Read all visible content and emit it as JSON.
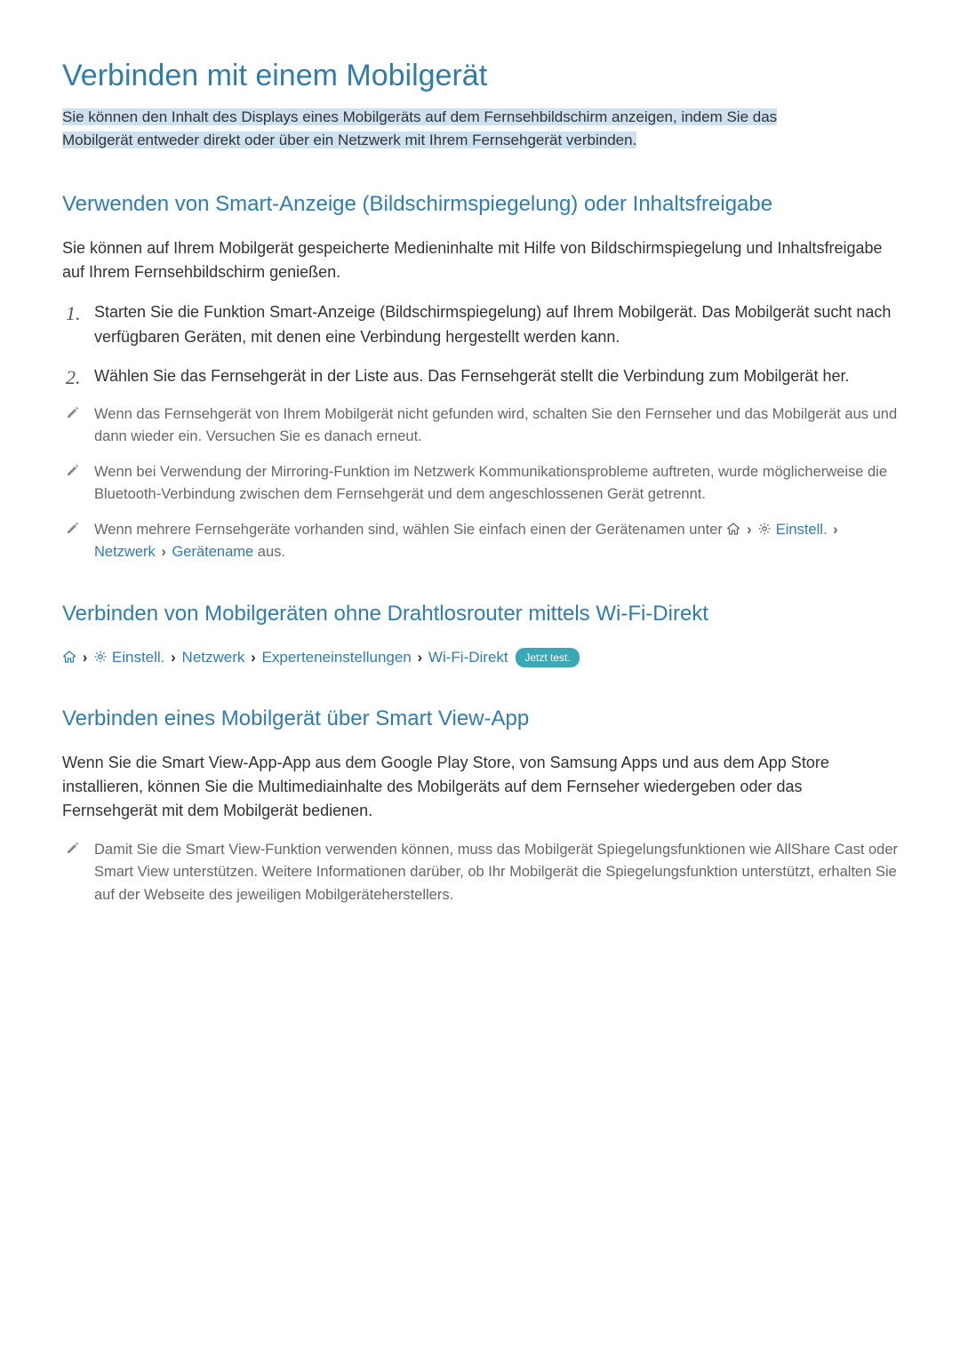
{
  "page": {
    "title": "Verbinden mit einem Mobilgerät",
    "intro_highlight1": "Sie können den Inhalt des Displays eines Mobilgeräts auf dem Fernsehbildschirm anzeigen, indem Sie das ",
    "intro_highlight2": "Mobilgerät entweder direkt oder über ein Netzwerk mit Ihrem Fernsehgerät verbinden."
  },
  "section1": {
    "heading": "Verwenden von Smart-Anzeige (Bildschirmspiegelung) oder Inhaltsfreigabe",
    "intro": "Sie können auf Ihrem Mobilgerät gespeicherte Medieninhalte mit Hilfe von Bildschirmspiegelung und Inhaltsfreigabe auf Ihrem Fernsehbildschirm genießen.",
    "step1": "Starten Sie die Funktion Smart-Anzeige (Bildschirmspiegelung) auf Ihrem Mobilgerät. Das Mobilgerät sucht nach verfügbaren Geräten, mit denen eine Verbindung hergestellt werden kann.",
    "step2": "Wählen Sie das Fernsehgerät in der Liste aus. Das Fernsehgerät stellt die Verbindung zum Mobilgerät her.",
    "note1": "Wenn das Fernsehgerät von Ihrem Mobilgerät nicht gefunden wird, schalten Sie den Fernseher und das Mobilgerät aus und dann wieder ein. Versuchen Sie es danach erneut.",
    "note2": "Wenn bei Verwendung der Mirroring-Funktion im Netzwerk Kommunikationsprobleme auftreten, wurde möglicherweise die Bluetooth-Verbindung zwischen dem Fernsehgerät und dem angeschlossenen Gerät getrennt.",
    "note3_pre": "Wenn mehrere Fernsehgeräte vorhanden sind, wählen Sie einfach einen der Gerätenamen unter ",
    "note3_path_settings": "Einstell.",
    "note3_path_network": "Netzwerk",
    "note3_path_devicename": "Gerätename",
    "note3_post": " aus."
  },
  "section2": {
    "heading": "Verbinden von Mobilgeräten ohne Drahtlosrouter mittels Wi-Fi-Direkt",
    "path_settings": "Einstell.",
    "path_network": "Netzwerk",
    "path_expert": "Experteneinstellungen",
    "path_wifidirect": "Wi-Fi-Direkt",
    "badge": "Jetzt test."
  },
  "section3": {
    "heading": "Verbinden eines Mobilgerät über Smart View-App",
    "body": "Wenn Sie die Smart View-App-App aus dem Google Play Store, von Samsung Apps und aus dem App Store installieren, können Sie die Multimediainhalte des Mobilgeräts auf dem Fernseher wiedergeben oder das Fernsehgerät mit dem Mobilgerät bedienen.",
    "note1": "Damit Sie die Smart View-Funktion verwenden können, muss das Mobilgerät Spiegelungsfunktionen wie AllShare Cast oder Smart View unterstützen. Weitere Informationen darüber, ob Ihr Mobilgerät die Spiegelungsfunktion unterstützt, erhalten Sie auf der Webseite des jeweiligen Mobilgeräteherstellers."
  }
}
